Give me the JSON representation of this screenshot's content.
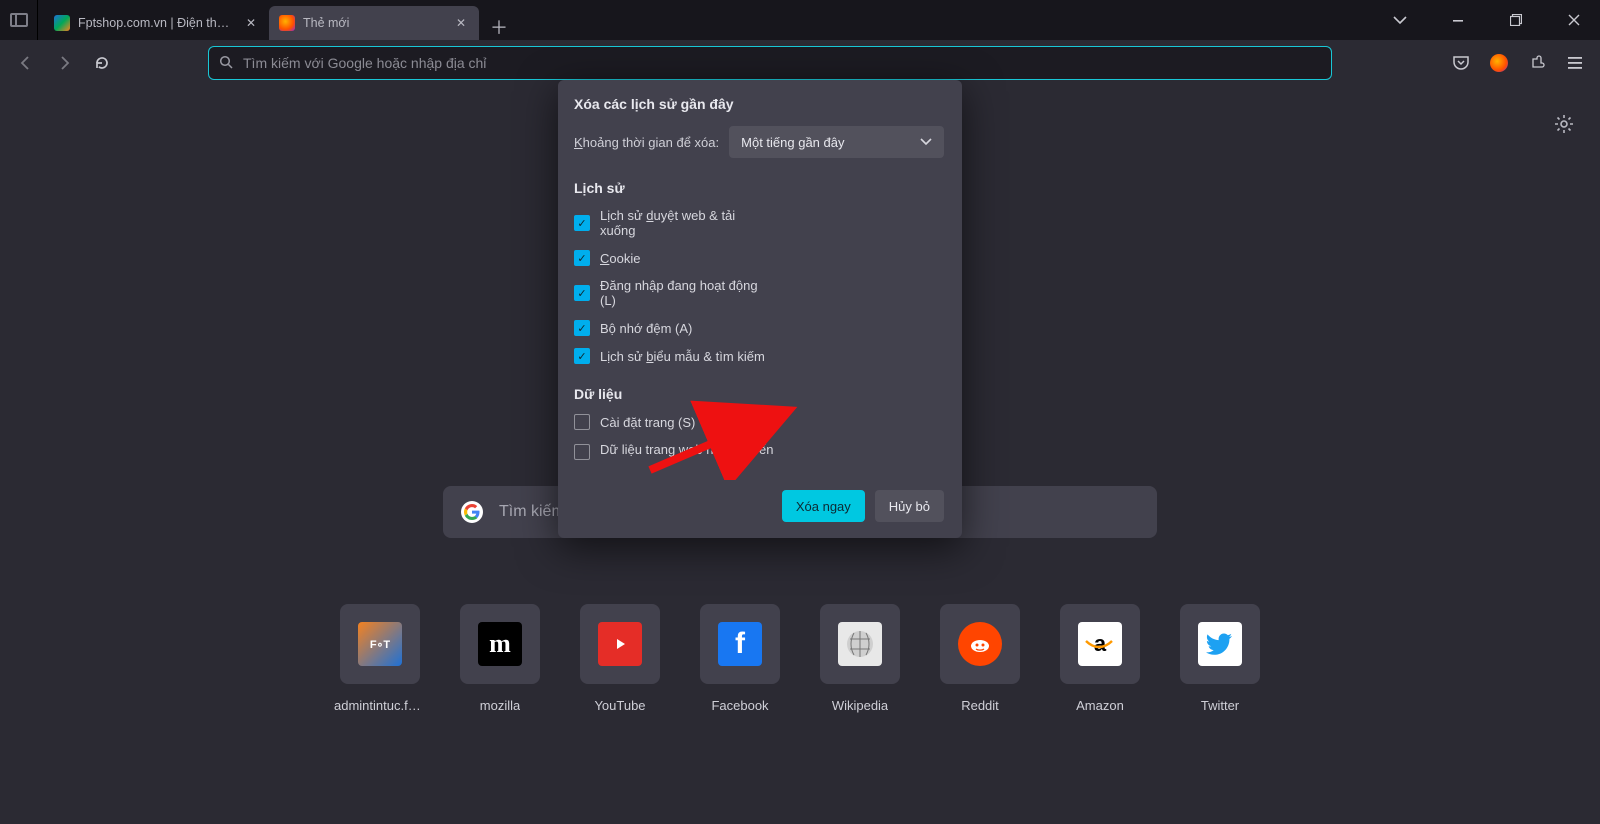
{
  "tabs": [
    {
      "label": "Fptshop.com.vn | Điện thoại, La",
      "active": false
    },
    {
      "label": "Thẻ mới",
      "active": true
    }
  ],
  "urlbar_placeholder": "Tìm kiếm với Google hoặc nhập địa chỉ",
  "center_search_placeholder": "Tìm kiếm với Go",
  "topsites": [
    {
      "label": "admintintuc.fp…"
    },
    {
      "label": "mozilla"
    },
    {
      "label": "YouTube"
    },
    {
      "label": "Facebook"
    },
    {
      "label": "Wikipedia"
    },
    {
      "label": "Reddit"
    },
    {
      "label": "Amazon"
    },
    {
      "label": "Twitter"
    }
  ],
  "dialog": {
    "title": "Xóa các lịch sử gần đây",
    "range_label": "Khoảng thời gian để xóa:",
    "range_value": "Một tiếng gần đây",
    "history_heading": "Lịch sử",
    "data_heading": "Dữ liệu",
    "check_browse": "Lịch sử duyệt web & tải xuống",
    "check_cookie": "Cookie",
    "check_login": "Đăng nhập đang hoạt động (L)",
    "check_cache": "Bộ nhớ đệm (A)",
    "check_form": "Lịch sử biểu mẫu & tìm kiếm",
    "check_site": "Cài đặt trang (S)",
    "check_offline": "Dữ liệu trang web ngoại tuyến",
    "btn_clear": "Xóa ngay",
    "btn_cancel": "Hủy bỏ"
  }
}
